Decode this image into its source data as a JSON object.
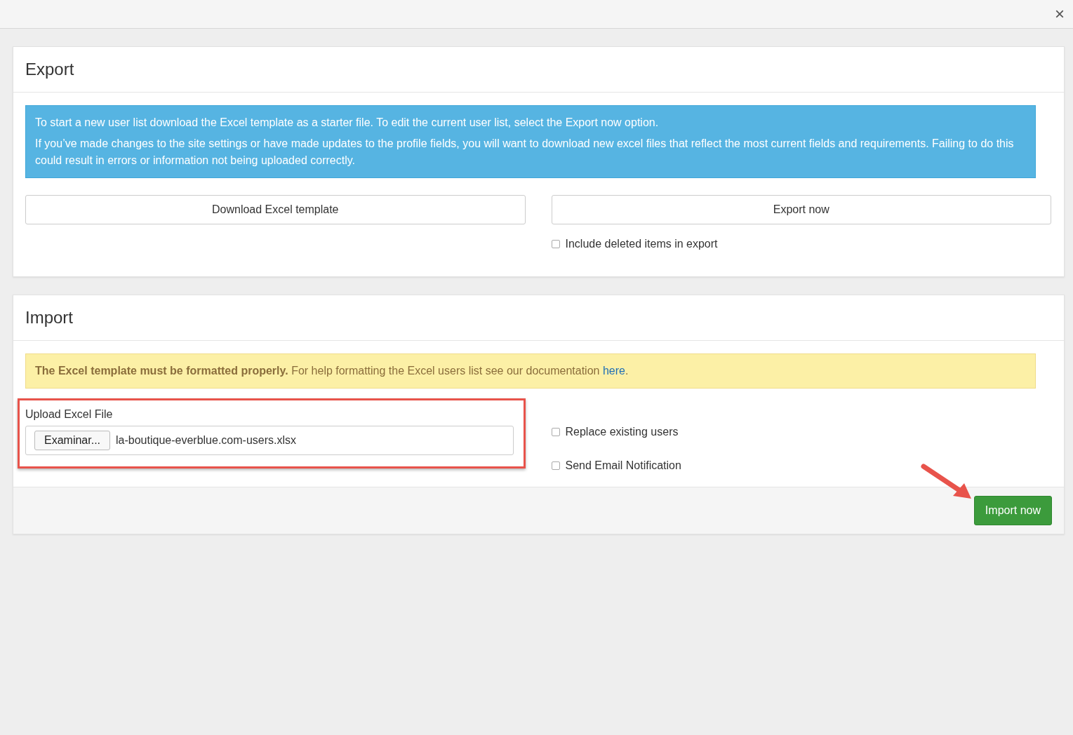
{
  "dialog": {
    "close_glyph": "×"
  },
  "export": {
    "title": "Export",
    "info_lines": [
      "To start a new user list download the Excel template as a starter file. To edit the current user list, select the Export now option.",
      "If you’ve made changes to the site settings or have made updates to the profile fields, you will want to download new excel files that reflect the most current fields and requirements. Failing to do this could result in errors or information not being uploaded correctly."
    ],
    "buttons": [
      "Download Excel template",
      "Export now"
    ],
    "include_deleted": {
      "label": "Include deleted items in export",
      "checked": false
    }
  },
  "import": {
    "title": "Import",
    "warning": "**The Excel template must be formatted properly.** For help formatting the Excel users list see our documentation",
    "warning_link": "here",
    "warning_end": ".",
    "upload": {
      "label": "Upload Excel File",
      "browse_button": "Examinar...",
      "value": "la-boutique-everblue.com-users.xlsx",
      "highlighted": true
    },
    "options": [
      {
        "label": "Replace existing users",
        "checked": false
      },
      {
        "label": "Send Email Notification",
        "checked": false
      }
    ],
    "submit": {
      "label": "Import now",
      "pointed_at": true
    }
  }
}
